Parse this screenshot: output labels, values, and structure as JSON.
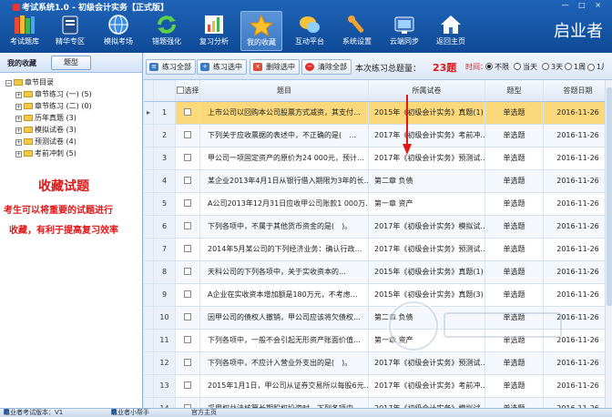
{
  "window": {
    "title": "考试系统1.0 - 初级会计实务【正式版】",
    "controls": "— □ ×"
  },
  "toolbar": {
    "items": [
      {
        "label": "考试题库",
        "icon": "books-icon"
      },
      {
        "label": "精华专区",
        "icon": "book-icon"
      },
      {
        "label": "模拟考场",
        "icon": "globe-icon"
      },
      {
        "label": "错题强化",
        "icon": "refresh-icon"
      },
      {
        "label": "复习分析",
        "icon": "bar-chart-icon"
      },
      {
        "label": "我的收藏",
        "icon": "star-icon"
      },
      {
        "label": "互动平台",
        "icon": "chat-icon"
      },
      {
        "label": "系统设置",
        "icon": "wrench-icon"
      },
      {
        "label": "云端同步",
        "icon": "sync-icon"
      },
      {
        "label": "返回主页",
        "icon": "home-icon"
      }
    ],
    "active": "我的收藏",
    "brand": "启业者"
  },
  "left": {
    "title": "我的收藏",
    "mode_button": "题型",
    "tree": [
      {
        "label": "章节目录",
        "level": 0
      },
      {
        "label": "章节练习 (一) (5)",
        "level": 1
      },
      {
        "label": "章节练习 (二) (0)",
        "level": 1
      },
      {
        "label": "历年真题 (3)",
        "level": 1
      },
      {
        "label": "模拟试卷 (3)",
        "level": 1
      },
      {
        "label": "预测试卷 (4)",
        "level": 1
      },
      {
        "label": "考前冲刺 (5)",
        "level": 1
      }
    ]
  },
  "annotation": {
    "title": "收藏试题",
    "line1": "考生可以将重要的试题进行",
    "line2": "收藏，有利于提高复习效率"
  },
  "actions": {
    "practice_all": "练习全部",
    "practice_selected": "练习选中",
    "delete_selected": "删除选中",
    "clear_all": "清除全部",
    "total_label": "本次练习总题量：",
    "total_value": "23题",
    "time_label": "时间：",
    "time_options": [
      "不限",
      "当天",
      "3天",
      "1周",
      "1月",
      "更早"
    ],
    "time_selected": "不限"
  },
  "table": {
    "headers": {
      "select": "选择",
      "question": "题目",
      "paper": "所属试卷",
      "type": "题型",
      "date": "答题日期"
    },
    "rows": [
      {
        "no": "1",
        "question": "上市公司以回购本公司股票方式减资，其支付…",
        "paper": "2015年《初级会计实务》真题(1)",
        "type": "单选题",
        "date": "2016-11-26"
      },
      {
        "no": "2",
        "question": "下列关于应收票据的表述中，不正确的是(　…",
        "paper": "2017年《初级会计实务》考前冲…",
        "type": "单选题",
        "date": "2016-11-26"
      },
      {
        "no": "3",
        "question": "甲公司一项固定资产的原价为24 000元，预计…",
        "paper": "2017年《初级会计实务》预测试…",
        "type": "单选题",
        "date": "2016-11-26"
      },
      {
        "no": "4",
        "question": "某企业2013年4月1日从银行借入期限为3年的长…",
        "paper": "第二章 负债",
        "type": "单选题",
        "date": "2016-11-26"
      },
      {
        "no": "5",
        "question": "A公司2013年12月31日应收甲公司账款1 000万…",
        "paper": "第一章 资产",
        "type": "单选题",
        "date": "2016-11-26"
      },
      {
        "no": "6",
        "question": "下列各项中，不属于其他货币资金的是(　)。",
        "paper": "2017年《初级会计实务》模拟试…",
        "type": "单选题",
        "date": "2016-11-26"
      },
      {
        "no": "7",
        "question": "2014年5月某公司的下列经济业务：确认行政…",
        "paper": "2017年《初级会计实务》预测试…",
        "type": "单选题",
        "date": "2016-11-26"
      },
      {
        "no": "8",
        "question": "天科公司的下列各项中，关于实收资本的…",
        "paper": "2015年《初级会计实务》真题(1)",
        "type": "单选题",
        "date": "2016-11-26"
      },
      {
        "no": "9",
        "question": "A企业在实收资本增加额是180万元，不考虑…",
        "paper": "2015年《初级会计实务》真题(3)",
        "type": "单选题",
        "date": "2016-11-26"
      },
      {
        "no": "10",
        "question": "因甲公司的债权人撤销，甲公司应该将欠债权…",
        "paper": "第二章 负债",
        "type": "单选题",
        "date": "2016-11-26"
      },
      {
        "no": "11",
        "question": "下列各项中，一般不会引起无形资产账面价值…",
        "paper": "第一章 资产",
        "type": "单选题",
        "date": "2016-11-26"
      },
      {
        "no": "12",
        "question": "下列各项中，不应计入营业外支出的是(　)。",
        "paper": "2017年《初级会计实务》预测试…",
        "type": "单选题",
        "date": "2016-11-26"
      },
      {
        "no": "13",
        "question": "2015年1月1日，甲公司从证券交易所以每股6元…",
        "paper": "2017年《初级会计实务》考前冲…",
        "type": "单选题",
        "date": "2016-11-26"
      },
      {
        "no": "14",
        "question": "采用权益法核算长期股权投资时，下列各项中…",
        "paper": "2017年《初级会计实务》模拟试…",
        "type": "单选题",
        "date": "2016-11-26"
      }
    ]
  },
  "status": {
    "version": "启业者考试版本：V1",
    "assistant": "启业者小帮手",
    "homepage": "官方主页"
  },
  "colors": {
    "accent": "#1f64b8",
    "selected_row": "#fbd97a",
    "annotation_red": "#e01818"
  }
}
